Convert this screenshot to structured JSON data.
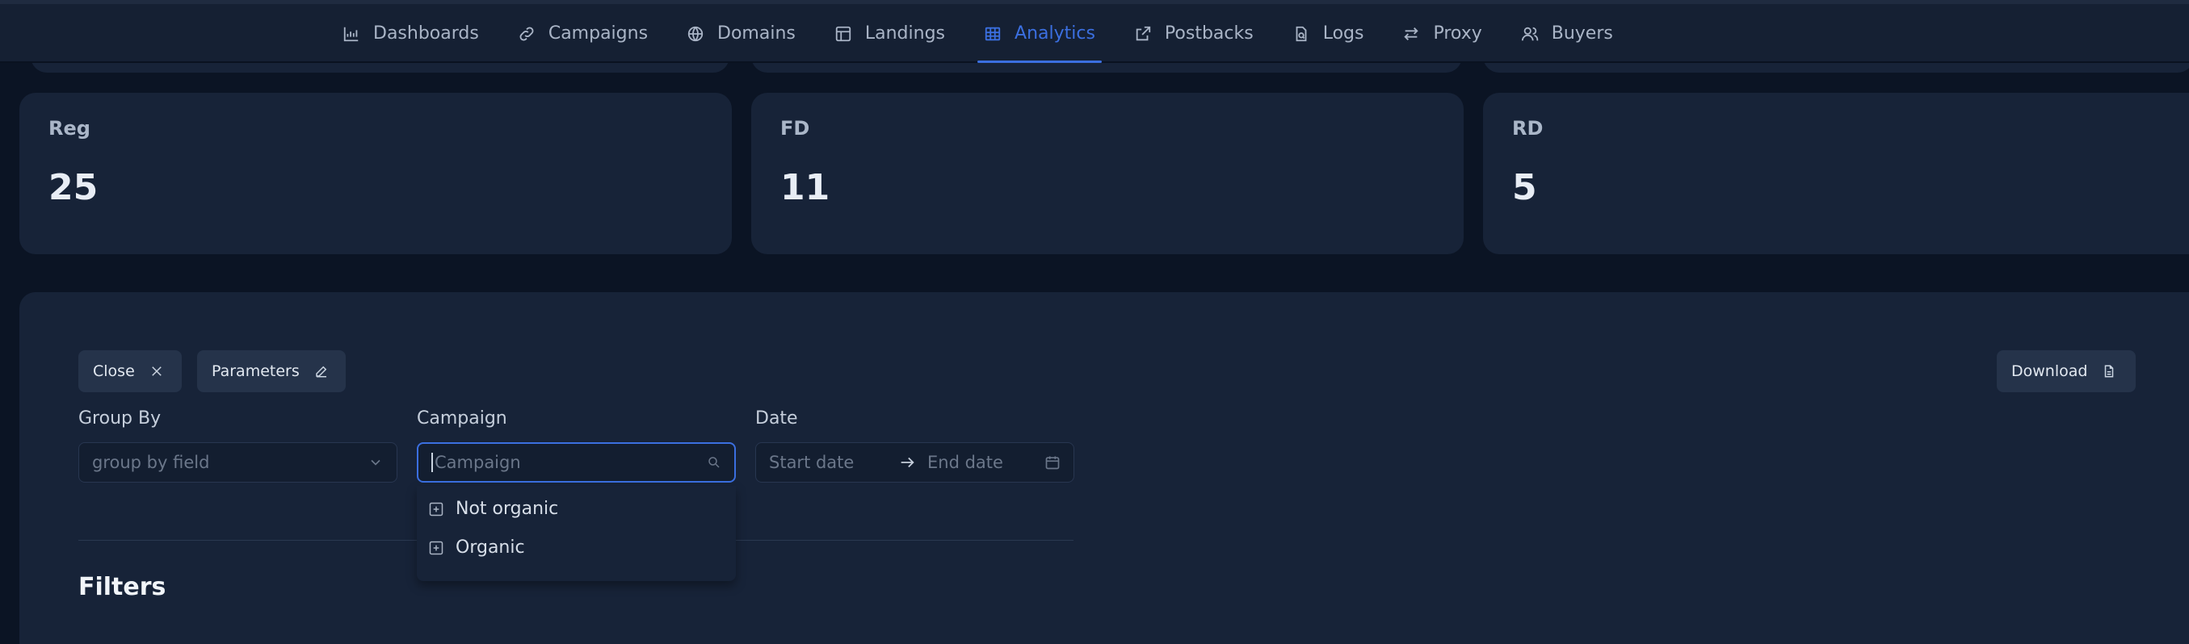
{
  "nav": {
    "items": [
      {
        "label": "Dashboards",
        "icon": "chart-icon",
        "active": false
      },
      {
        "label": "Campaigns",
        "icon": "link-icon",
        "active": false
      },
      {
        "label": "Domains",
        "icon": "globe-icon",
        "active": false
      },
      {
        "label": "Landings",
        "icon": "layout-icon",
        "active": false
      },
      {
        "label": "Analytics",
        "icon": "table-icon",
        "active": true
      },
      {
        "label": "Postbacks",
        "icon": "external-link-icon",
        "active": false
      },
      {
        "label": "Logs",
        "icon": "file-search-icon",
        "active": false
      },
      {
        "label": "Proxy",
        "icon": "arrows-icon",
        "active": false
      },
      {
        "label": "Buyers",
        "icon": "users-icon",
        "active": false
      }
    ],
    "accent_color": "#3b6fe0"
  },
  "stats": [
    {
      "label": "Reg",
      "value": "25"
    },
    {
      "label": "FD",
      "value": "11"
    },
    {
      "label": "RD",
      "value": "5"
    }
  ],
  "toolbar": {
    "close_label": "Close",
    "parameters_label": "Parameters",
    "download_label": "Download"
  },
  "fields": {
    "group_by": {
      "label": "Group By",
      "placeholder": "group by field"
    },
    "campaign": {
      "label": "Campaign",
      "placeholder": "Campaign"
    },
    "date": {
      "label": "Date",
      "start_placeholder": "Start date",
      "end_placeholder": "End date"
    }
  },
  "campaign_options": [
    {
      "label": "Not organic"
    },
    {
      "label": "Organic"
    }
  ],
  "filters": {
    "title": "Filters"
  }
}
